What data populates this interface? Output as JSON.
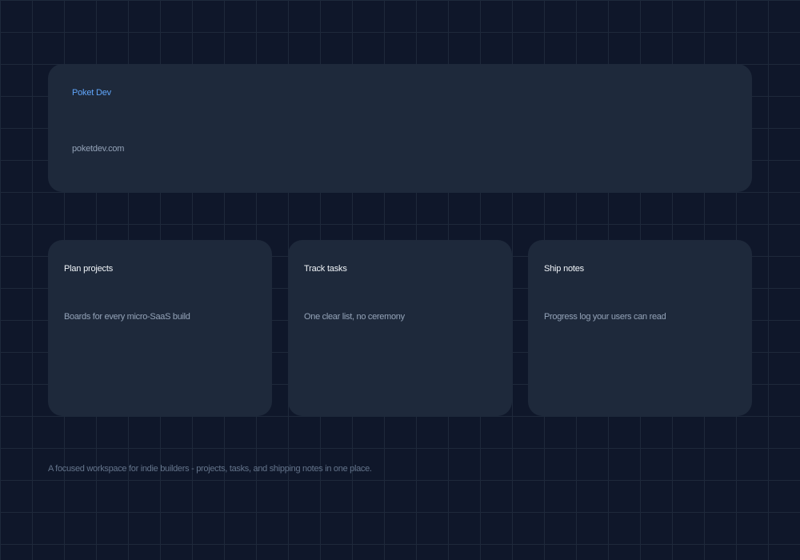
{
  "hero": {
    "brand": "Poket Dev",
    "domain": "poketdev.com"
  },
  "features": [
    {
      "title": "Plan projects",
      "description": "Boards for every micro-SaaS build"
    },
    {
      "title": "Track tasks",
      "description": "One clear list, no ceremony"
    },
    {
      "title": "Ship notes",
      "description": "Progress log your users can read"
    }
  ],
  "footer": {
    "tagline": "A focused workspace for indie builders - projects, tasks, and shipping notes in one place."
  },
  "colors": {
    "background": "#0f172a",
    "grid_line": "#1e293b",
    "card": "#1e293b",
    "accent": "#60a5fa",
    "heading": "#f1f5f9",
    "muted": "#94a3b8",
    "subtle": "#64748b"
  }
}
